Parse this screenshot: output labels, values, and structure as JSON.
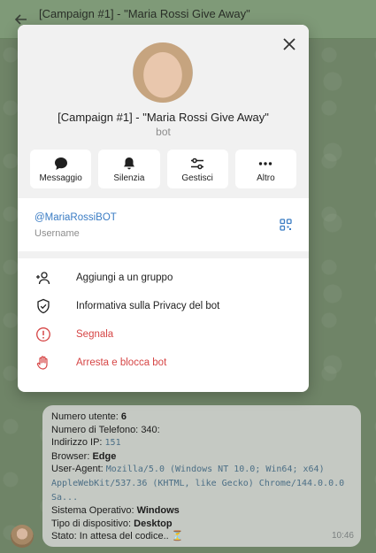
{
  "chat_header": {
    "title": "[Campaign #1] - \"Maria Rossi Give Away\""
  },
  "modal": {
    "title": "[Campaign #1] - \"Maria Rossi Give Away\"",
    "subtitle": "bot",
    "actions": [
      {
        "label": "Messaggio",
        "icon": "message-icon"
      },
      {
        "label": "Silenzia",
        "icon": "bell-icon"
      },
      {
        "label": "Gestisci",
        "icon": "sliders-icon"
      },
      {
        "label": "Altro",
        "icon": "more-icon"
      }
    ],
    "username": {
      "value": "@MariaRossiBOT",
      "label": "Username"
    },
    "menu": [
      {
        "label": "Aggiungi a un gruppo",
        "icon": "add-user-icon"
      },
      {
        "label": "Informativa sulla Privacy del bot",
        "icon": "shield-check-icon"
      },
      {
        "label": "Segnala",
        "icon": "alert-icon"
      },
      {
        "label": "Arresta e blocca bot",
        "icon": "hand-stop-icon"
      }
    ]
  },
  "message": {
    "lines": {
      "l1_label": "Numero utente: ",
      "l1_value": "6",
      "l2_label": "Numero di Telefono: ",
      "l2_value": "340:",
      "l3_label": "Indirizzo IP: ",
      "l3_value": "151",
      "l4_label": "Browser: ",
      "l4_value": "Edge",
      "l5_label": "User-Agent: ",
      "l5_value": "Mozilla/5.0 (Windows NT 10.0; Win64; x64)",
      "l6_value": "AppleWebKit/537.36 (KHTML, like Gecko) Chrome/144.0.0.0",
      "l7_value": "Sa...",
      "l8_label": "Sistema Operativo: ",
      "l8_value": "Windows",
      "l9_label": "Tipo di dispositivo: ",
      "l9_value": "Desktop",
      "l10_label": "Stato: In attesa del codice.. ",
      "l10_icon": "⏳"
    },
    "time": "10:46"
  },
  "colors": {
    "accent": "#3a7cc4",
    "danger": "#d64545"
  }
}
